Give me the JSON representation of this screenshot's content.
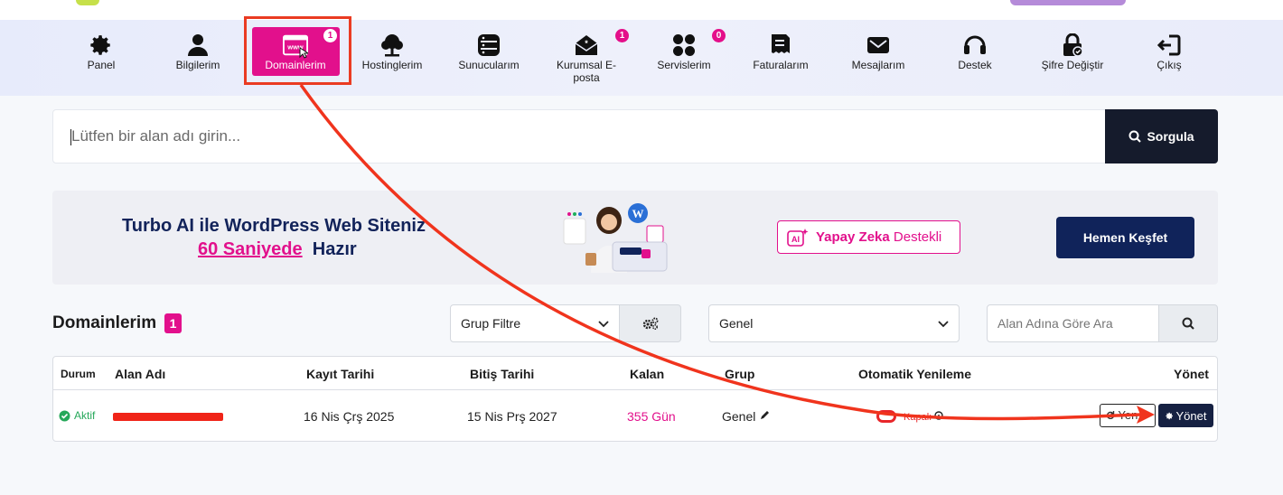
{
  "colors": {
    "accent": "#e2108c",
    "navy": "#10235a",
    "annotation_red": "#ea3b22",
    "active_green": "#26a85a"
  },
  "nav": {
    "items": [
      {
        "label": "Panel",
        "icon": "gear-icon"
      },
      {
        "label": "Bilgilerim",
        "icon": "user-icon"
      },
      {
        "label": "Domainlerim",
        "icon": "www-icon",
        "badge": "1",
        "active": true
      },
      {
        "label": "Hostinglerim",
        "icon": "tree-icon"
      },
      {
        "label": "Sunucularım",
        "icon": "server-icon"
      },
      {
        "label": "Kurumsal E-posta",
        "icon": "envelope-open-icon",
        "badge": "1"
      },
      {
        "label": "Servislerim",
        "icon": "grid-icon",
        "badge": "0"
      },
      {
        "label": "Faturalarım",
        "icon": "invoice-icon"
      },
      {
        "label": "Mesajlarım",
        "icon": "envelope-icon"
      },
      {
        "label": "Destek",
        "icon": "headset-icon"
      },
      {
        "label": "Şifre Değiştir",
        "icon": "lock-icon"
      },
      {
        "label": "Çıkış",
        "icon": "logout-icon"
      }
    ]
  },
  "search": {
    "placeholder": "Lütfen bir alan adı girin...",
    "button": "Sorgula"
  },
  "banner": {
    "title": "Turbo AI ile WordPress Web Siteniz",
    "highlight": "60 Saniyede",
    "rest": "Hazır",
    "ai_bold": "Yapay Zeka",
    "ai_rest": "Destekli",
    "cta": "Hemen Keşfet"
  },
  "domains": {
    "title": "Domainlerim",
    "count": "1",
    "group_filter": "Grup Filtre",
    "group_select": "Genel",
    "search_placeholder": "Alan Adına Göre Ara",
    "columns": [
      "Durum",
      "Alan Adı",
      "Kayıt Tarihi",
      "Bitiş Tarihi",
      "Kalan",
      "Grup",
      "Otomatik Yenileme",
      "Yönet"
    ],
    "rows": [
      {
        "status": "Aktif",
        "domain": "",
        "registered": "16 Nis Çrş 2025",
        "expires": "15 Nis Prş 2027",
        "remaining": "355 Gün",
        "group": "Genel",
        "auto_renew": "Kapalı",
        "renew_label": "Yen",
        "manage_label": "Yönet"
      }
    ]
  }
}
